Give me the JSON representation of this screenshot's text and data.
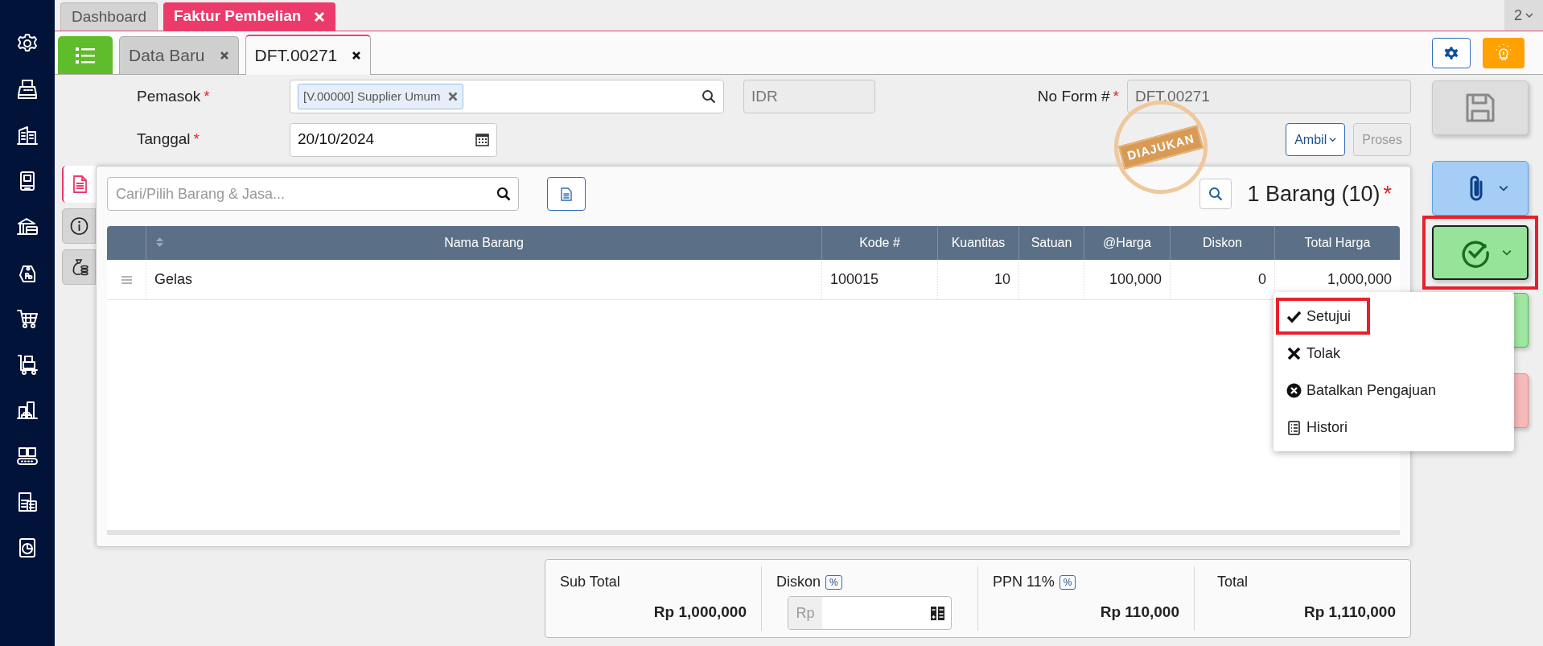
{
  "sidebar": [
    {
      "kind": "gear"
    },
    {
      "kind": "register"
    },
    {
      "kind": "building"
    },
    {
      "kind": "book"
    },
    {
      "kind": "bank"
    },
    {
      "kind": "tag"
    },
    {
      "kind": "cart"
    },
    {
      "kind": "trolley"
    },
    {
      "kind": "city"
    },
    {
      "kind": "conveyor"
    },
    {
      "kind": "tax"
    },
    {
      "kind": "report"
    }
  ],
  "top_tabs": [
    {
      "label": "Dashboard",
      "selected": false,
      "closable": false
    },
    {
      "label": "Faktur Pembelian",
      "selected": true,
      "closable": true
    }
  ],
  "window_count": "2",
  "doc_tabs": [
    {
      "kind": "list",
      "selected": false
    },
    {
      "kind": "tab",
      "label": "Data Baru",
      "selected": false
    },
    {
      "kind": "tab",
      "label": "DFT.00271",
      "selected": true
    }
  ],
  "form": {
    "supplier": {
      "label": "Pemasok",
      "required_mark": "*",
      "tag": "[V.00000] Supplier Umum"
    },
    "currency": "IDR",
    "form_no": {
      "label": "No Form #",
      "required_mark": "*",
      "value": "DFT.00271"
    },
    "date": {
      "label": "Tanggal",
      "required_mark": "*",
      "value": "20/10/2024"
    },
    "buttons": [
      {
        "kind": "dropdown",
        "label": "Ambil",
        "disabled": false
      },
      {
        "kind": "plain",
        "label": "Proses",
        "disabled": true
      }
    ]
  },
  "stamp": "DIAJUKAN",
  "side_tabs": [
    {
      "kind": "document",
      "selected": true
    },
    {
      "kind": "info",
      "selected": false
    },
    {
      "kind": "money",
      "selected": false
    }
  ],
  "item_search": {
    "placeholder": "Cari/Pilih Barang & Jasa..."
  },
  "item_count": {
    "text": "1 Barang (10)",
    "required_mark": "*"
  },
  "table": {
    "columns": [
      "Nama Barang",
      "Kode #",
      "Kuantitas",
      "Satuan",
      "@Harga",
      "Diskon",
      "Total Harga"
    ],
    "rows": [
      {
        "cells": [
          "Gelas",
          "100015",
          "10",
          null,
          "100,000",
          "0",
          "1,000,000"
        ]
      }
    ]
  },
  "actions": [
    {
      "kind": "save",
      "disabled": true,
      "highlighted": false
    },
    {
      "kind": "attach",
      "disabled": false,
      "highlighted": false
    },
    {
      "kind": "approve",
      "disabled": false,
      "highlighted": true
    },
    {
      "kind": "green",
      "disabled": false,
      "highlighted": false
    },
    {
      "kind": "red",
      "disabled": false,
      "highlighted": false
    }
  ],
  "approval_menu": [
    {
      "kind": "approve",
      "label": "Setujui",
      "highlighted": true
    },
    {
      "kind": "reject",
      "label": "Tolak",
      "highlighted": false
    },
    {
      "kind": "cancel",
      "label": "Batalkan Pengajuan",
      "highlighted": false
    },
    {
      "kind": "history",
      "label": "Histori",
      "highlighted": false
    }
  ],
  "summary": [
    {
      "kind": "value",
      "label": "Sub Total",
      "value": "Rp 1,000,000"
    },
    {
      "kind": "input",
      "label": "Diskon",
      "badge": "%",
      "prefix": "Rp"
    },
    {
      "kind": "value",
      "label": "PPN 11%",
      "badge": "%",
      "value": "Rp 110,000"
    },
    {
      "kind": "value",
      "label": "Total",
      "value": "Rp 1,110,000"
    }
  ]
}
